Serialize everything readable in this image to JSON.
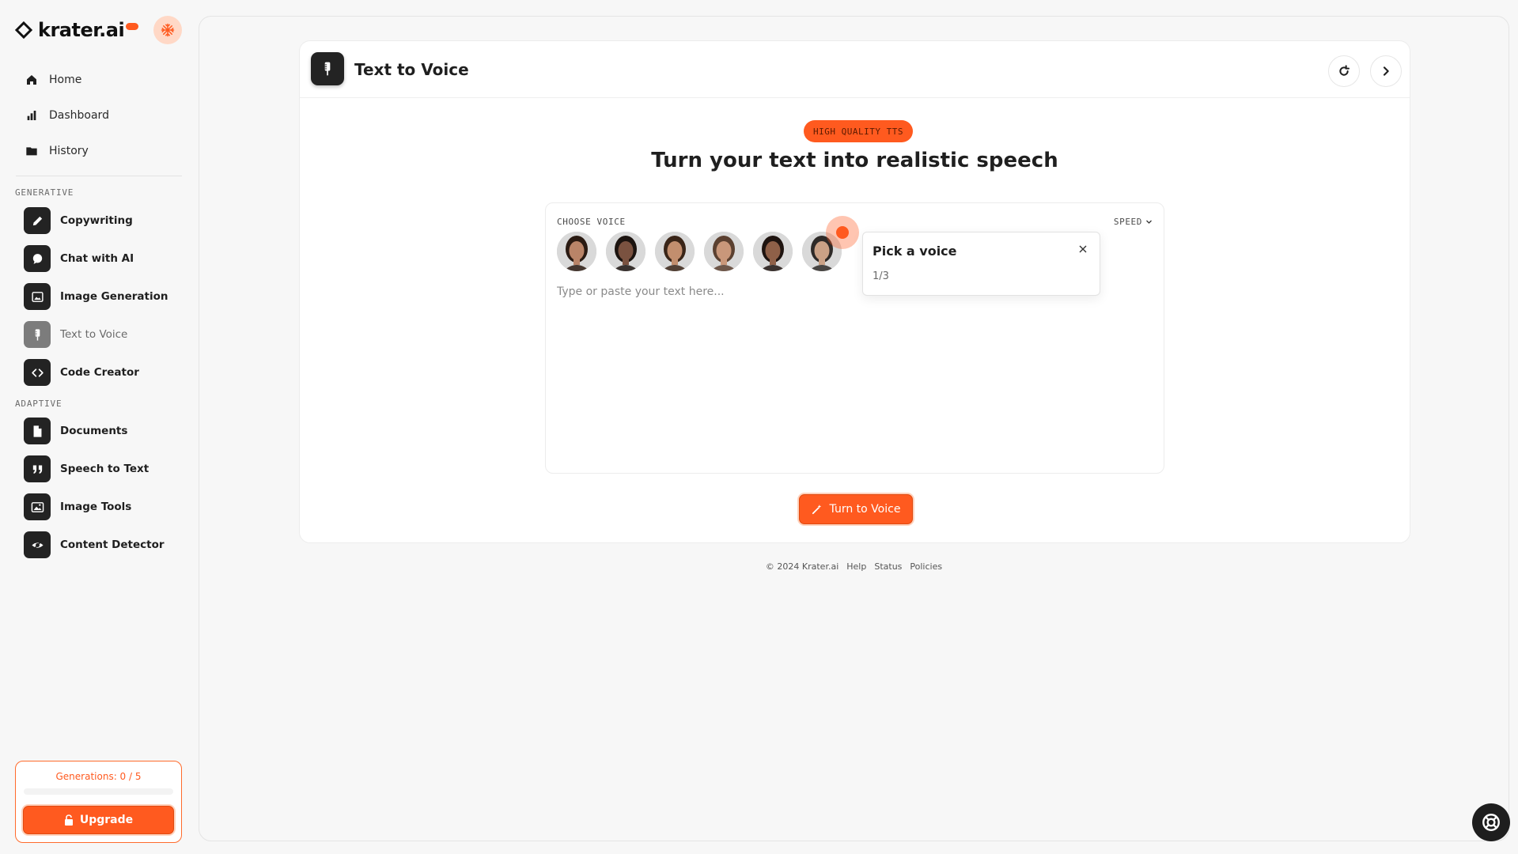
{
  "brand": {
    "name": "krater.ai",
    "accent": "#ff5a1f"
  },
  "sidebar": {
    "nav": [
      {
        "label": "Home",
        "icon": "home-icon"
      },
      {
        "label": "Dashboard",
        "icon": "bar-chart-icon"
      },
      {
        "label": "History",
        "icon": "folder-icon"
      }
    ],
    "sections": [
      {
        "label": "GENERATIVE",
        "items": [
          {
            "label": "Copywriting",
            "icon": "pencil-icon"
          },
          {
            "label": "Chat with AI",
            "icon": "chat-bubble-icon"
          },
          {
            "label": "Image Generation",
            "icon": "image-icon"
          },
          {
            "label": "Text to Voice",
            "icon": "microphone-icon",
            "active": true
          },
          {
            "label": "Code Creator",
            "icon": "code-icon"
          }
        ]
      },
      {
        "label": "ADAPTIVE",
        "items": [
          {
            "label": "Documents",
            "icon": "document-icon"
          },
          {
            "label": "Speech to Text",
            "icon": "quote-icon"
          },
          {
            "label": "Image Tools",
            "icon": "photo-edit-icon"
          },
          {
            "label": "Content Detector",
            "icon": "eye-scan-icon"
          }
        ]
      }
    ],
    "generations": {
      "label": "Generations: 0 / 5",
      "used": 0,
      "limit": 5
    },
    "upgrade_label": "Upgrade"
  },
  "main": {
    "page_title": "Text to Voice",
    "badge": "HIGH QUALITY TTS",
    "headline": "Turn your text into realistic speech",
    "choose_voice_label": "CHOOSE VOICE",
    "speed_label": "SPEED",
    "voices": [
      {
        "name": "voice-1",
        "skin": "#b98468",
        "hair": "#2a1a12"
      },
      {
        "name": "voice-2",
        "skin": "#7a5240",
        "hair": "#1c1410"
      },
      {
        "name": "voice-3",
        "skin": "#c28e6e",
        "hair": "#3a2518"
      },
      {
        "name": "voice-4",
        "skin": "#c9977a",
        "hair": "#5b4030"
      },
      {
        "name": "voice-5",
        "skin": "#8f6048",
        "hair": "#1f1410"
      },
      {
        "name": "voice-6",
        "skin": "#caa186",
        "hair": "#2e2a28"
      }
    ],
    "text_placeholder": "Type or paste your text here...",
    "tooltip": {
      "title": "Pick a voice",
      "step": "1/3"
    },
    "submit_label": "Turn to Voice"
  },
  "footer": {
    "copyright": "© 2024 Krater.ai",
    "links": [
      "Help",
      "Status",
      "Policies"
    ]
  }
}
